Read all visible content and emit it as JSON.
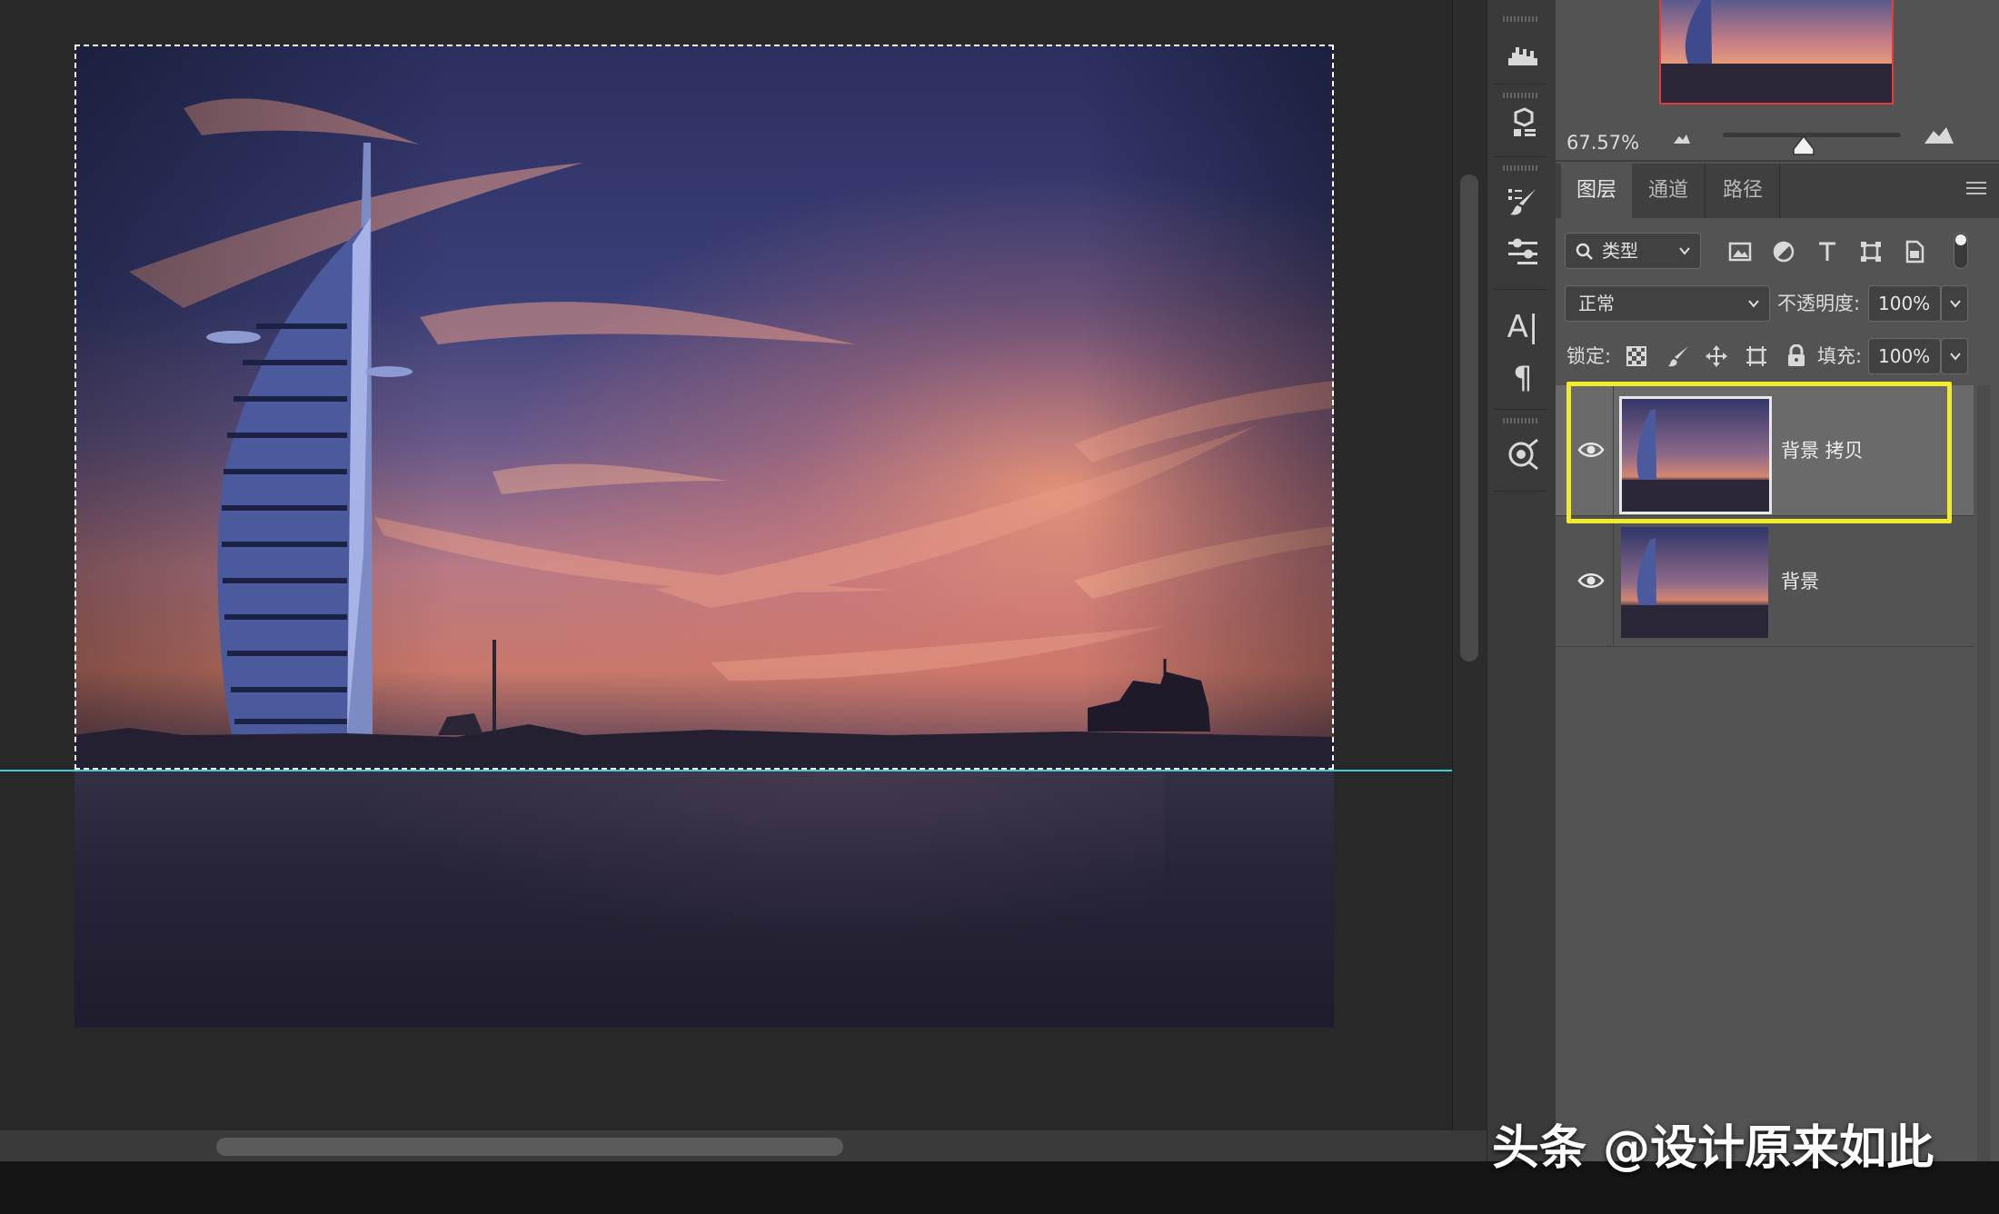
{
  "navigator": {
    "zoom": "67.57%"
  },
  "layers_panel": {
    "tabs": [
      {
        "label": "图层",
        "active": true
      },
      {
        "label": "通道",
        "active": false
      },
      {
        "label": "路径",
        "active": false
      }
    ],
    "filter": {
      "kind_label": "类型",
      "icons": [
        "image-filter-icon",
        "adjustment-filter-icon",
        "type-filter-icon",
        "shape-filter-icon",
        "smart-object-filter-icon"
      ]
    },
    "blend_mode": "正常",
    "opacity_label": "不透明度:",
    "opacity_value": "100%",
    "lock_label": "锁定:",
    "lock_icons": [
      "lock-transparent-icon",
      "lock-image-icon",
      "lock-position-icon",
      "lock-artboard-icon",
      "lock-all-icon"
    ],
    "fill_label": "填充:",
    "fill_value": "100%",
    "layers": [
      {
        "name": "背景 拷贝",
        "visible": true,
        "selected": true
      },
      {
        "name": "背景",
        "visible": true,
        "selected": false
      }
    ],
    "highlight_color": "#f2ea2c"
  },
  "tools": [
    "histogram-icon",
    "3d-icon",
    "brush-settings-icon",
    "properties-icon",
    "character-icon",
    "paragraph-icon",
    "adjustments-icon"
  ],
  "canvas": {
    "guide_color": "#3fd0d4",
    "selection": "marquee"
  },
  "watermark": "头条 @设计原来如此"
}
